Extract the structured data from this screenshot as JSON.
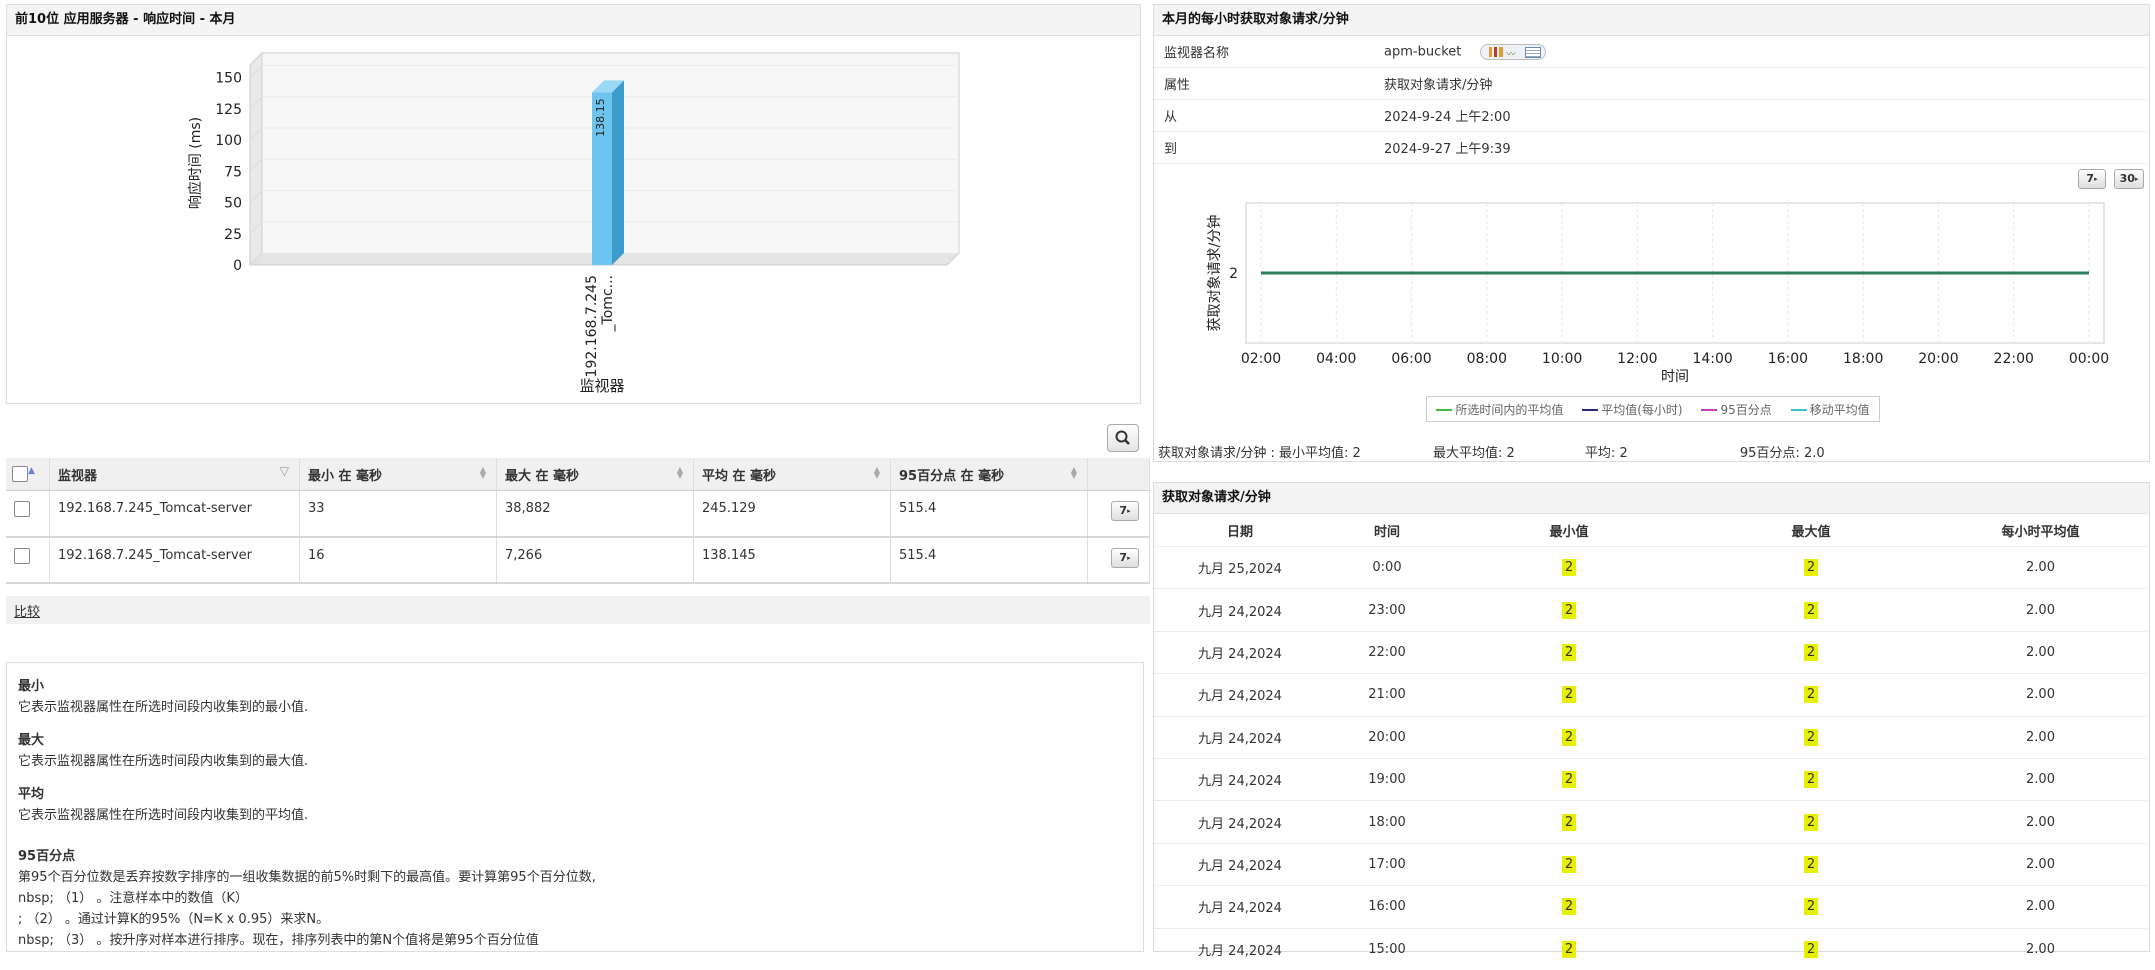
{
  "left_chart": {
    "title": "前10位 应用服务器 - 响应时间 - 本月",
    "chart_data": {
      "type": "bar",
      "categories": [
        "192.168.7.245_Tomc..."
      ],
      "category_lines": [
        "192.168.7.245",
        "_Tomc..."
      ],
      "values": [
        138.15
      ],
      "value_labels": [
        "138.15"
      ],
      "ylabel": "响应时间 (ms)",
      "xlabel": "监视器",
      "yticks": [
        "0",
        "25",
        "50",
        "75",
        "100",
        "125",
        "150"
      ],
      "ylim": [
        0,
        160
      ],
      "bar_color": "#6cc4ef"
    }
  },
  "search_icon": "search-icon",
  "table": {
    "headers": [
      "监视器",
      "最小 在 毫秒",
      "最大 在 毫秒",
      "平均 在 毫秒",
      "95百分点 在 毫秒"
    ],
    "rows": [
      {
        "monitor": "192.168.7.245_Tomcat-server",
        "min": "33",
        "max": "38,882",
        "avg": "245.129",
        "p95": "515.4",
        "btn": "7"
      },
      {
        "monitor": "192.168.7.245_Tomcat-server",
        "min": "16",
        "max": "7,266",
        "avg": "138.145",
        "p95": "515.4",
        "btn": "7"
      }
    ],
    "compare_link": "比较"
  },
  "descriptions": [
    {
      "term": "最小",
      "def": "它表示监视器属性在所选时间段内收集到的最小值."
    },
    {
      "term": "最大",
      "def": "它表示监视器属性在所选时间段内收集到的最大值."
    },
    {
      "term": "平均",
      "def": "它表示监视器属性在所选时间段内收集到的平均值."
    },
    {
      "term": "95百分点",
      "def": "第95个百分位数是丢弃按数字排序的一组收集数据的前5%时剩下的最高值。要计算第95个百分位数,"
    }
  ],
  "desc_lines": [
    "nbsp; （1） 。注意样本中的数值（K）",
    "; （2） 。通过计算K的95%（N=K x 0.95）来求N。",
    "nbsp; （3） 。按升序对样本进行排序。现在，排序列表中的第N个值将是第95个百分位值"
  ],
  "right_top": {
    "title": "本月的每小时获取对象请求/分钟",
    "info": [
      {
        "key": "监视器名称",
        "val": "apm-bucket"
      },
      {
        "key": "属性",
        "val": "获取对象请求/分钟"
      },
      {
        "key": "从",
        "val": "2024-9-24 上午2:00"
      },
      {
        "key": "到",
        "val": "2024-9-27 上午9:39"
      }
    ],
    "btn_7": "7",
    "btn_30": "30",
    "chart_data": {
      "type": "line",
      "x": [
        "02:00",
        "04:00",
        "06:00",
        "08:00",
        "10:00",
        "12:00",
        "14:00",
        "16:00",
        "18:00",
        "20:00",
        "22:00",
        "00:00"
      ],
      "series": [
        {
          "values": [
            2,
            2,
            2,
            2,
            2,
            2,
            2,
            2,
            2,
            2,
            2,
            2
          ],
          "color": "#2e7d5b"
        }
      ],
      "ylabel": "获取对象请求/分钟",
      "xlabel": "时间",
      "yticks": [
        "2"
      ],
      "legend": [
        {
          "name": "所选时间内的平均值",
          "color": "#3cbf3c"
        },
        {
          "name": "平均值(每小时)",
          "color": "#2a2a7a"
        },
        {
          "name": "95百分点",
          "color": "#c040c0"
        },
        {
          "name": "移动平均值",
          "color": "#40c0c0"
        }
      ]
    },
    "stats": {
      "label": "获取对象请求/分钟 : 最小平均值:",
      "min_avg": "2",
      "max_avg_label": "最大平均值:",
      "max_avg": "2",
      "avg_label": "平均:",
      "avg": "2",
      "p95_label": "95百分点:",
      "p95": "2.0"
    }
  },
  "right_bottom": {
    "title": "获取对象请求/分钟",
    "headers": [
      "日期",
      "时间",
      "最小值",
      "最大值",
      "每小时平均值"
    ],
    "rows": [
      [
        "九月 25,2024",
        "0:00",
        "2",
        "2",
        "2.00"
      ],
      [
        "九月 24,2024",
        "23:00",
        "2",
        "2",
        "2.00"
      ],
      [
        "九月 24,2024",
        "22:00",
        "2",
        "2",
        "2.00"
      ],
      [
        "九月 24,2024",
        "21:00",
        "2",
        "2",
        "2.00"
      ],
      [
        "九月 24,2024",
        "20:00",
        "2",
        "2",
        "2.00"
      ],
      [
        "九月 24,2024",
        "19:00",
        "2",
        "2",
        "2.00"
      ],
      [
        "九月 24,2024",
        "18:00",
        "2",
        "2",
        "2.00"
      ],
      [
        "九月 24,2024",
        "17:00",
        "2",
        "2",
        "2.00"
      ],
      [
        "九月 24,2024",
        "16:00",
        "2",
        "2",
        "2.00"
      ],
      [
        "九月 24,2024",
        "15:00",
        "2",
        "2",
        "2.00"
      ]
    ]
  }
}
